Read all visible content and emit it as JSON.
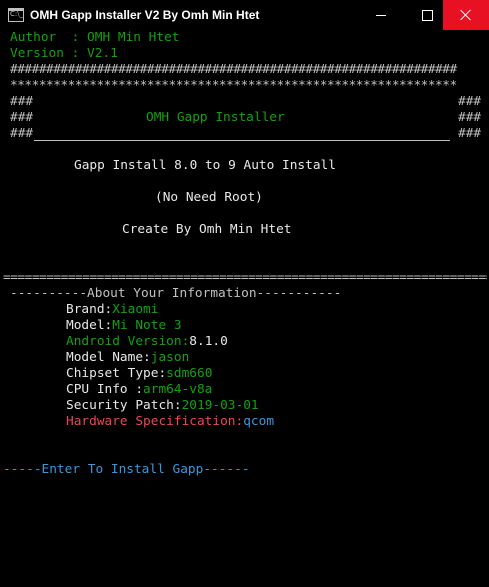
{
  "window": {
    "title": "OMH Gapp Installer V2 By Omh Min Htet",
    "icon": "console-icon",
    "icon_text": "C:\\_",
    "controls": [
      "minimize",
      "maximize",
      "close"
    ],
    "close_color": "#e81123"
  },
  "header": {
    "author_label": "Author  : ",
    "author_value": "OMH Min Htet",
    "version_label": "Version : ",
    "version_value": "V2.1",
    "hash_row": "##############################################################",
    "star_row": "**************************************************************"
  },
  "banner": {
    "hash": "###",
    "title": "OMH Gapp Installer",
    "line1": "Gapp Install 8.0 to 9 Auto Install",
    "line2": "(No Need Root)",
    "line3": "Create By Omh Min Htet"
  },
  "separator": "====================================================================",
  "info": {
    "heading": "----------About Your Information-----------",
    "brand_label": "Brand:",
    "brand_value": "Xiaomi",
    "model_label": "Model:",
    "model_value": "Mi Note 3",
    "android_label": "Android Version:",
    "android_value": "8.1.0",
    "model_name_label": "Model Name:",
    "model_name_value": "jason",
    "chipset_label": "Chipset Type:",
    "chipset_value": "sdm660",
    "cpu_label": "CPU Info :",
    "cpu_value": "arm64-v8a",
    "patch_label": "Security Patch:",
    "patch_value": "2019-03-01",
    "hardware_label": "Hardware Specification:",
    "hardware_value": "qcom"
  },
  "prompt": "-----Enter To Install Gapp------",
  "colors": {
    "background": "#000000",
    "default_text": "#c0c0c0",
    "green": "#13a10e",
    "cyan": "#3a96dd",
    "red": "#e74856"
  }
}
